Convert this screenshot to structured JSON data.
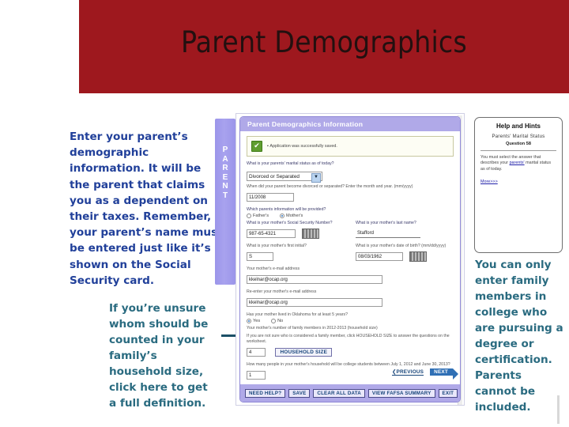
{
  "slide": {
    "title": "Parent Demographics",
    "banner_color": "#9e181e",
    "left_narrative": "Enter your parent’s demographic information.  It will be the parent that claims you as a dependent on their taxes.  Remember, your parent’s name must be entered just like it’s shown on the Social Security card.",
    "household_note": "If you’re unsure whom should be counted in your family’s household size, click here to get a full definition.",
    "college_note": "You can only enter  family members in college who are pursuing a degree or certification. Parents cannot be included.",
    "vertical_tab_label": "PARENT",
    "tab_color": "#9b95ea",
    "note_color": "#2a6b80",
    "narrative_color": "#21409a"
  },
  "app": {
    "window_title": "Parent Demographics Information",
    "success_message": "Application was successfully saved.",
    "fields": {
      "marital_status": {
        "label": "What is your parents' marital status as of today?",
        "value": "Divorced or Separated"
      },
      "separation_date": {
        "label": "When did your parent become divorced or separated? Enter the month and year. (mm/yyyy)",
        "value": "11/2008"
      },
      "which_parent": {
        "label": "Which parents information will be provided?",
        "options": [
          "Father's",
          "Mother's"
        ],
        "selected": "Mother's"
      },
      "ssn": {
        "label": "What is your mother's Social Security Number?",
        "value": "987-65-4321"
      },
      "last_name": {
        "label": "What is your mother's last name?",
        "value": "Stafford"
      },
      "first_initial": {
        "label": "What is your mother's first initial?",
        "value": "S"
      },
      "dob": {
        "label": "What is your mother's date of birth? (mm/dd/yyyy)",
        "value": "08/03/1962"
      },
      "email": {
        "label": "Your mother's e-mail address",
        "value": "kkelnar@ocap.org"
      },
      "email_confirm": {
        "label": "Re-enter your mother's e-mail address",
        "value": "kkelnar@ocap.org"
      },
      "residency": {
        "label": "Has your mother lived in Oklahoma for at least 5 years?",
        "options": [
          "Yes",
          "No"
        ],
        "selected": "Yes"
      },
      "household_size": {
        "label": "Your mother's number of family members in 2012-2013 (household size)",
        "hint": "If you are not sure who is considered a family member, click HOUSEHOLD SIZE to answer the questions on the worksheet.",
        "value": "4",
        "button_label": "HOUSEHOLD SIZE"
      },
      "college_count": {
        "label": "How many people in your mother's household will be college students between July 1, 2012 and June 30, 2013?",
        "value": "1"
      }
    },
    "nav": {
      "previous": "PREVIOUS",
      "next": "NEXT"
    },
    "footer_buttons": [
      "NEED HELP?",
      "SAVE",
      "CLEAR ALL DATA",
      "VIEW FAFSA SUMMARY"
    ],
    "exit_button": "EXIT"
  },
  "help": {
    "title": "Help and Hints",
    "subtitle": "Parents' Marital Status",
    "question": "Question 58",
    "body_before_link": "You must select the answer that describes your ",
    "body_link": "parents'",
    "body_after_link": " marital status as of today.",
    "more_link": "More>>>"
  }
}
